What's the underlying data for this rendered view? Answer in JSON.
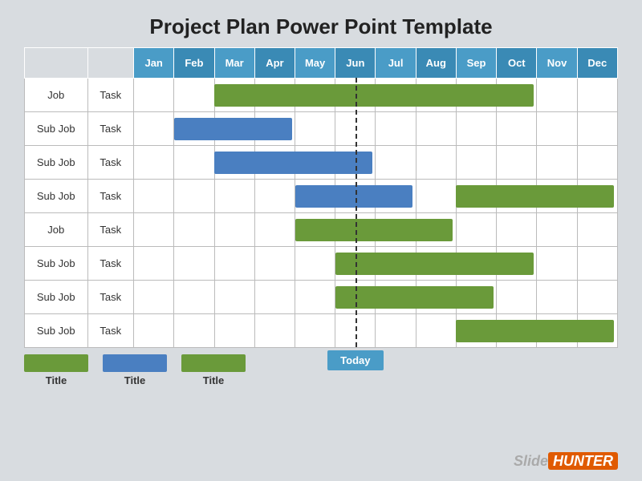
{
  "title": "Project Plan Power Point Template",
  "months": [
    "Jan",
    "Feb",
    "Mar",
    "Apr",
    "May",
    "Jun",
    "Jul",
    "Aug",
    "Sep",
    "Oct",
    "Nov",
    "Dec"
  ],
  "rows": [
    {
      "label1": "Job",
      "label2": "Task",
      "bar": {
        "color": "green",
        "start": 2,
        "span": 8
      }
    },
    {
      "label1": "Sub Job",
      "label2": "Task",
      "bar": {
        "color": "blue",
        "start": 1,
        "span": 3
      }
    },
    {
      "label1": "Sub Job",
      "label2": "Task",
      "bar": {
        "color": "blue",
        "start": 2,
        "span": 4
      }
    },
    {
      "label1": "Sub Job",
      "label2": "Task",
      "bar2": [
        {
          "color": "blue",
          "start": 4,
          "span": 3
        },
        {
          "color": "green",
          "start": 8,
          "span": 4
        }
      ]
    },
    {
      "label1": "Job",
      "label2": "Task",
      "bar": {
        "color": "green",
        "start": 4,
        "span": 4
      }
    },
    {
      "label1": "Sub Job",
      "label2": "Task",
      "bar": {
        "color": "green",
        "start": 5,
        "span": 5
      }
    },
    {
      "label1": "Sub Job",
      "label2": "Task",
      "bar": {
        "color": "green",
        "start": 5,
        "span": 4
      }
    },
    {
      "label1": "Sub Job",
      "label2": "Task",
      "bar": {
        "color": "green",
        "start": 8,
        "span": 4
      }
    }
  ],
  "today_label": "Today",
  "today_col": 5,
  "legend": [
    {
      "color": "green",
      "label": "Title"
    },
    {
      "color": "blue",
      "label": "Title"
    },
    {
      "color": "green",
      "label": "Title"
    }
  ],
  "slidehunter": {
    "slide": "Slide",
    "hunter": "HUNTER"
  }
}
